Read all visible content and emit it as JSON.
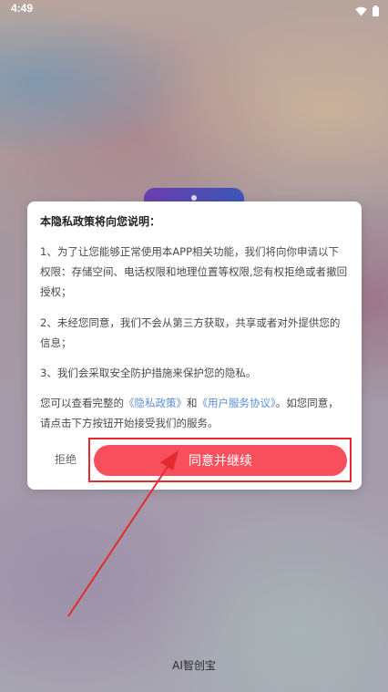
{
  "status_bar": {
    "time": "4:49",
    "icons": [
      "wifi-icon",
      "battery-icon"
    ]
  },
  "dialog": {
    "title": "本隐私政策将向您说明：",
    "item1": "1、为了让您能够正常使用本APP相关功能，我们将向你申请以下权限：存储空间、电话权限和地理位置等权限,您有权拒绝或者撤回授权；",
    "item2": "2、未经您同意，我们不会从第三方获取，共享或者对外提供您的信息；",
    "item3": "3、我们会采取安全防护措施来保护您的隐私。",
    "notice": {
      "prefix": "您可以查看完整的",
      "privacy_link": "《隐私政策》",
      "middle": "和",
      "user_link": "《用户服务协议》",
      "suffix": "。如您同意，请点击下方按钮开始接受我们的服务。"
    },
    "refuse_label": "拒绝",
    "agree_label": "同意并继续"
  },
  "app_name": "AI智创宝",
  "colors": {
    "accent": "#f74f5b",
    "link": "#5b8fd6",
    "annotation": "#e4292f"
  }
}
